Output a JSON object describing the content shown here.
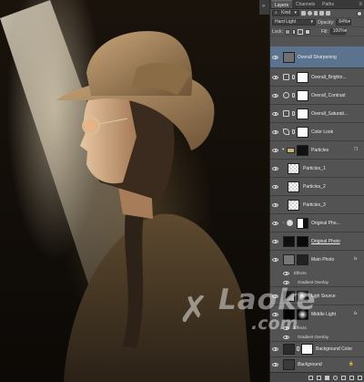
{
  "panel": {
    "tabs": [
      "Layers",
      "Channels",
      "Paths"
    ],
    "active_tab": "Layers",
    "filter_kind": "Kind",
    "blend_mode": "Hard Light",
    "opacity_label": "Opacity:",
    "opacity_value": "64%",
    "lock_label": "Lock:",
    "fill_label": "Fill:",
    "fill_value": "100%"
  },
  "layers": [
    {
      "name": "Overall Sharpening",
      "selected": true
    },
    {
      "name": "Overall_Brightn..."
    },
    {
      "name": "Overall_Contrast"
    },
    {
      "name": "Overall_Saturati..."
    },
    {
      "name": "Color Look"
    },
    {
      "name": "Particles"
    },
    {
      "name": "Particles_1"
    },
    {
      "name": "Particles_2"
    },
    {
      "name": "Particles_3"
    },
    {
      "name": "Original Pho..."
    },
    {
      "name": "Original Photo"
    },
    {
      "name": "Main Photo"
    },
    {
      "name": "Effects"
    },
    {
      "name": "Gradient Overlay"
    },
    {
      "name": "Ligh Source"
    },
    {
      "name": "Middle Light"
    },
    {
      "name": "Effects"
    },
    {
      "name": "Gradient Overlay"
    },
    {
      "name": "Background Color"
    },
    {
      "name": "Background"
    }
  ],
  "watermark": {
    "brand": "Laoke",
    "domain": ".com"
  },
  "colors": {
    "panel_bg": "#535353",
    "selected_row": "#5c7390",
    "photo_tone": "#6b5333"
  }
}
